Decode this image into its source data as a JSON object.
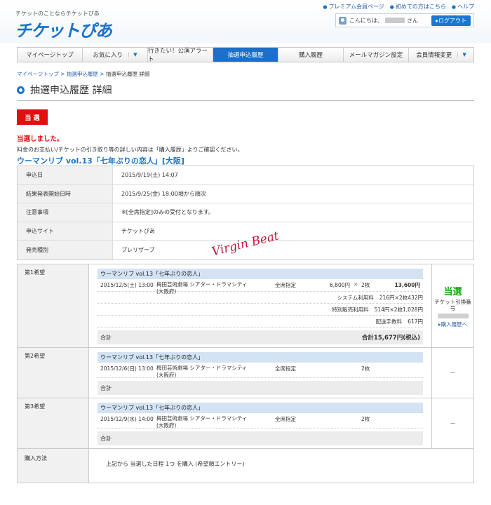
{
  "header": {
    "tagline": "チケットのことならチケットぴあ",
    "logo": "チケットぴあ",
    "links": [
      "プレミアム会員ページ",
      "初めての方はこちら",
      "ヘルプ"
    ],
    "greeting_prefix": "こんにちは、",
    "greeting_suffix": "さん",
    "logout": "▸ログアウト"
  },
  "nav": [
    {
      "label": "マイページトップ"
    },
    {
      "label": "お気に入り"
    },
    {
      "label": "行きたい！公演アラート"
    },
    {
      "label": "抽選申込履歴"
    },
    {
      "label": "購入履歴"
    },
    {
      "label": "メールマガジン設定"
    },
    {
      "label": "会員情報変更"
    }
  ],
  "breadcrumb": {
    "items": [
      "マイページトップ",
      "抽選申込履歴"
    ],
    "current": "抽選申込履歴 詳細",
    "sep": " > "
  },
  "page_title": "抽選申込履歴 詳細",
  "status": {
    "badge": "当 選",
    "message": "当選しました。",
    "note": "料金のお支払い/チケットの引き取り等の詳しい内容は「購入履歴」よりご確認ください。"
  },
  "event_title": "ウーマンリブ vol.13「七年ぶりの恋人」[大阪]",
  "info": [
    {
      "key": "申込日",
      "value": "2015/9/19(土) 14:07"
    },
    {
      "key": "結果発表開始日時",
      "value": "2015/9/25(金) 18:00頃から順次"
    },
    {
      "key": "注意事項",
      "value": "※[全席指定]のみの受付となります。"
    },
    {
      "key": "申込サイト",
      "value": "チケットぴあ"
    },
    {
      "key": "発売種別",
      "value": "プレリザーブ"
    }
  ],
  "choices": [
    {
      "label": "第1希望",
      "title": "ウーマンリブ vol.13「七年ぶりの恋人」",
      "date": "2015/12/5(土) 13:00",
      "venue": "梅田芸術劇場 シアター・ドラマシティ(大阪府)",
      "seat": "全席指定",
      "price": "6,800円",
      "x": "×",
      "qty": "2枚",
      "amount": "13,600円",
      "fees": [
        {
          "name": "システム利用料",
          "price": "216円",
          "x": "×",
          "qty": "2枚",
          "amount": "432円"
        },
        {
          "name": "特別販売利用料",
          "price": "514円",
          "x": "×",
          "qty": "2枚",
          "amount": "1,028円"
        },
        {
          "name": "配送手数料",
          "price": "",
          "x": "",
          "qty": "",
          "amount": "617円"
        }
      ],
      "total_label": "合計",
      "total": "合計15,677円(税込)",
      "result": "当選",
      "ticket_label": "チケット引換番号",
      "purchase_link": "▸購入履歴へ"
    },
    {
      "label": "第2希望",
      "title": "ウーマンリブ vol.13「七年ぶりの恋人」",
      "date": "2015/12/6(日) 13:00",
      "venue": "梅田芸術劇場 シアター・ドラマシティ(大阪府)",
      "seat": "全席指定",
      "qty": "2枚",
      "total_label": "合計",
      "result": "－"
    },
    {
      "label": "第3希望",
      "title": "ウーマンリブ vol.13「七年ぶりの恋人」",
      "date": "2015/12/9(水) 14:00",
      "venue": "梅田芸術劇場 シアター・ドラマシティ(大阪府)",
      "seat": "全席指定",
      "qty": "2枚",
      "total_label": "合計",
      "result": "－"
    }
  ],
  "purchase_method": {
    "label": "購入方法",
    "value": "上記から 当選した日程 1つ を購入 (希望順エントリー)"
  },
  "watermark": "Virgin Beat"
}
